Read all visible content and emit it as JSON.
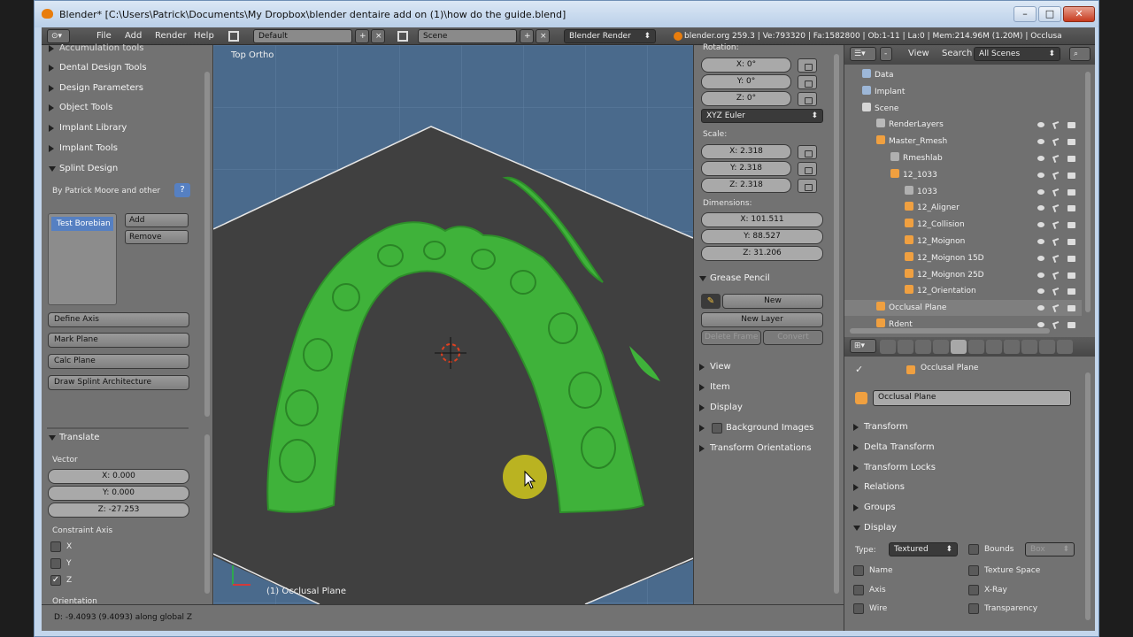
{
  "window": {
    "title": "Blender* [C:\\Users\\Patrick\\Documents\\My Dropbox\\blender dentaire add on (1)\\how do the guide.blend]"
  },
  "header": {
    "menus": [
      "File",
      "Add",
      "Render",
      "Help"
    ],
    "layout": "Default",
    "scene": "Scene",
    "engine": "Blender Render",
    "info": "blender.org 259.3 | Ve:793320 | Fa:1582800 | Ob:1-11 | La:0 | Mem:214.96M (1.20M) | Occlusa"
  },
  "toolshelf": {
    "top_cut": "Accumulation tools",
    "panels": [
      "Dental Design Tools",
      "Design Parameters",
      "Object Tools",
      "Implant Library",
      "Implant Tools"
    ],
    "splint": {
      "title": "Splint Design",
      "author": "By Patrick Moore and other",
      "help": "?",
      "list_item": "Test Borebian",
      "add": "Add",
      "remove": "Remove",
      "buttons": [
        "Define Axis",
        "Mark Plane",
        "Calc Plane",
        "Draw Splint Architecture"
      ]
    },
    "translate": {
      "title": "Translate",
      "vector_label": "Vector",
      "x": "X: 0.000",
      "y": "Y: 0.000",
      "z": "Z: -27.253",
      "constraint_label": "Constraint Axis",
      "axes": [
        {
          "label": "X",
          "checked": false
        },
        {
          "label": "Y",
          "checked": false
        },
        {
          "label": "Z",
          "checked": true
        }
      ],
      "orientation_label": "Orientation"
    }
  },
  "viewport": {
    "view_name": "Top Ortho",
    "object_label": "(1) Occlusal Plane"
  },
  "npanel": {
    "rotation_label": "Rotation:",
    "rotation": [
      "X: 0°",
      "Y: 0°",
      "Z: 0°"
    ],
    "rotation_mode": "XYZ Euler",
    "scale_label": "Scale:",
    "scale": [
      "X: 2.318",
      "Y: 2.318",
      "Z: 2.318"
    ],
    "dimensions_label": "Dimensions:",
    "dimensions": [
      "X: 101.511",
      "Y: 88.527",
      "Z: 31.206"
    ],
    "grease_pencil": {
      "title": "Grease Pencil",
      "new": "New",
      "new_layer": "New Layer",
      "delete_frame": "Delete Frame",
      "convert": "Convert"
    },
    "sections": [
      "View",
      "Item",
      "Display",
      "Background Images",
      "Transform Orientations"
    ]
  },
  "outliner": {
    "view": "View",
    "search": "Search",
    "filter": "All Scenes",
    "items": [
      {
        "label": "Data",
        "indent": 0,
        "color": "#9db7d8"
      },
      {
        "label": "Implant",
        "indent": 0,
        "color": "#9db7d8"
      },
      {
        "label": "Scene",
        "indent": 0,
        "color": "#d6d6d6"
      },
      {
        "label": "RenderLayers",
        "indent": 1,
        "color": "#b9b9b9"
      },
      {
        "label": "Master_Rmesh",
        "indent": 1,
        "color": "#f0a040"
      },
      {
        "label": "Rmeshlab",
        "indent": 2,
        "color": "#b0b0b0"
      },
      {
        "label": "12_1033",
        "indent": 2,
        "color": "#f0a040"
      },
      {
        "label": "1033",
        "indent": 3,
        "color": "#b0b0b0"
      },
      {
        "label": "12_Aligner",
        "indent": 3,
        "color": "#f0a040"
      },
      {
        "label": "12_Collision",
        "indent": 3,
        "color": "#f0a040"
      },
      {
        "label": "12_Moignon",
        "indent": 3,
        "color": "#f0a040"
      },
      {
        "label": "12_Moignon 15D",
        "indent": 3,
        "color": "#f0a040"
      },
      {
        "label": "12_Moignon 25D",
        "indent": 3,
        "color": "#f0a040"
      },
      {
        "label": "12_Orientation",
        "indent": 3,
        "color": "#f0a040"
      },
      {
        "label": "Occlusal Plane",
        "indent": 1,
        "color": "#f0a040"
      },
      {
        "label": "Rdent",
        "indent": 1,
        "color": "#f0a040"
      }
    ]
  },
  "properties": {
    "context_object": "Occlusal Plane",
    "object_name": "Occlusal Plane",
    "sections": [
      "Transform",
      "Delta Transform",
      "Transform Locks",
      "Relations",
      "Groups"
    ],
    "display": {
      "title": "Display",
      "type_label": "Type:",
      "type_value": "Textured",
      "bounds": "Bounds",
      "bounds_value": "Box",
      "name": "Name",
      "texture_space": "Texture Space",
      "axis": "Axis",
      "xray": "X-Ray",
      "wire": "Wire",
      "transparency": "Transparency"
    }
  },
  "status": {
    "text": "D: -9.4093 (9.4093) along global Z"
  },
  "colors": {
    "mesh": "#3fb23a",
    "selection": "#5680c2",
    "panel": "#727272",
    "grid_blue": "#4f6f8f"
  }
}
